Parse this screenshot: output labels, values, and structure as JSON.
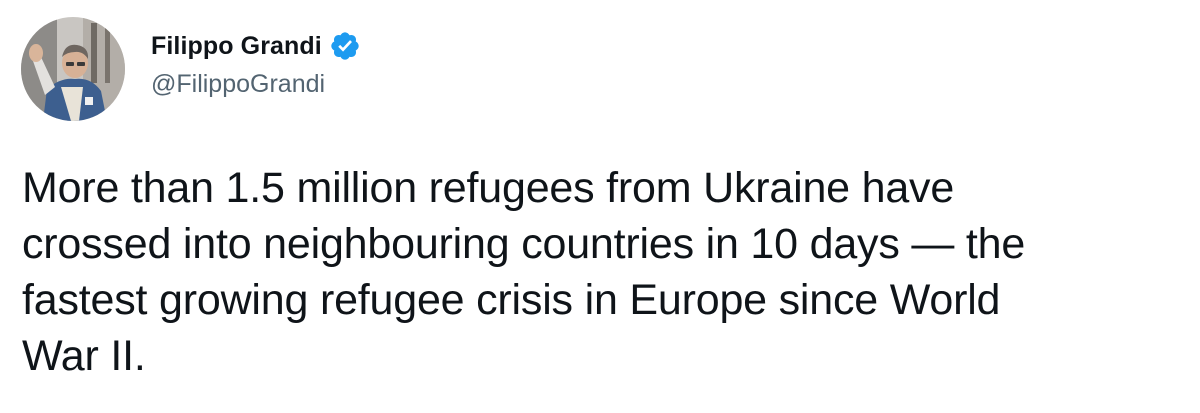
{
  "tweet": {
    "author": {
      "display_name": "Filippo Grandi",
      "handle": "@FilippoGrandi",
      "verified": true,
      "avatar_icon": "profile-photo"
    },
    "text": "More than 1.5 million refugees from Ukraine have\ncrossed into neighbouring countries in 10 days — the\nfastest growing refugee crisis in Europe since World\nWar II."
  },
  "colors": {
    "text_primary": "#0f1419",
    "text_secondary": "#536471",
    "verified_badge": "#1d9bf0",
    "background": "#ffffff"
  }
}
